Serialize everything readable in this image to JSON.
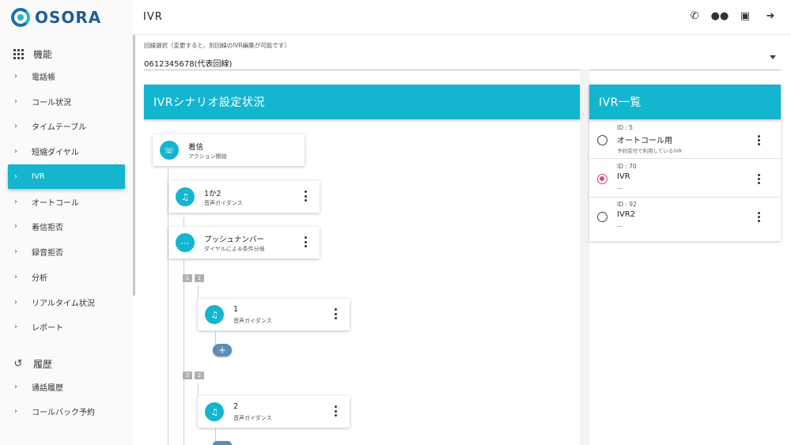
{
  "app": {
    "logo_text": "OSORA"
  },
  "header": {
    "title": "IVR",
    "icons": [
      "phone-forward-icon",
      "people-icon",
      "contact-card-icon",
      "logout-arrow-icon"
    ]
  },
  "sidebar": {
    "sections": [
      {
        "label": "機能",
        "icon": "grid-icon",
        "items": [
          {
            "label": "電話帳"
          },
          {
            "label": "コール状況"
          },
          {
            "label": "タイムテーブル"
          },
          {
            "label": "短縮ダイヤル"
          },
          {
            "label": "IVR",
            "active": true
          },
          {
            "label": "オートコール"
          },
          {
            "label": "着信拒否"
          },
          {
            "label": "録音拒否"
          },
          {
            "label": "分析"
          },
          {
            "label": "リアルタイム状況"
          },
          {
            "label": "レポート"
          }
        ]
      },
      {
        "label": "履歴",
        "icon": "history-icon",
        "items": [
          {
            "label": "通話履歴"
          },
          {
            "label": "コールバック予約"
          }
        ]
      }
    ]
  },
  "line_select": {
    "label": "回線選択（変更すると、別回線のIVR編集が可能です）",
    "value": "0612345678(代表回線)"
  },
  "scenario_panel": {
    "title": "IVRシナリオ設定状況",
    "nodes": [
      {
        "title": "着信",
        "subtitle": "アクション開始",
        "icon": "incoming-call-icon"
      },
      {
        "title": "1か2",
        "subtitle": "音声ガイダンス",
        "icon": "audio-library-icon"
      },
      {
        "title": "プッシュナンバー",
        "subtitle": "ダイヤルによる条件分岐",
        "icon": "dialpad-icon"
      },
      {
        "title": "1",
        "subtitle": "音声ガイダンス",
        "icon": "audio-library-icon"
      },
      {
        "title": "2",
        "subtitle": "音声ガイダンス",
        "icon": "audio-library-icon"
      }
    ],
    "branch_tags": [
      [
        "1",
        "1"
      ],
      [
        "2",
        "2"
      ]
    ],
    "add_label": "+"
  },
  "ivr_list": {
    "title": "IVR一覧",
    "items": [
      {
        "id": "ID : 5",
        "name": "オートコール用",
        "desc": "予約受付で利用しているIVR",
        "selected": false
      },
      {
        "id": "ID : 70",
        "name": "IVR",
        "desc": "—",
        "selected": true
      },
      {
        "id": "ID : 92",
        "name": "IVR2",
        "desc": "—",
        "selected": false
      }
    ]
  },
  "colors": {
    "accent": "#13b5cf",
    "selected_radio": "#e0457b",
    "add_button": "#5b8db5"
  }
}
